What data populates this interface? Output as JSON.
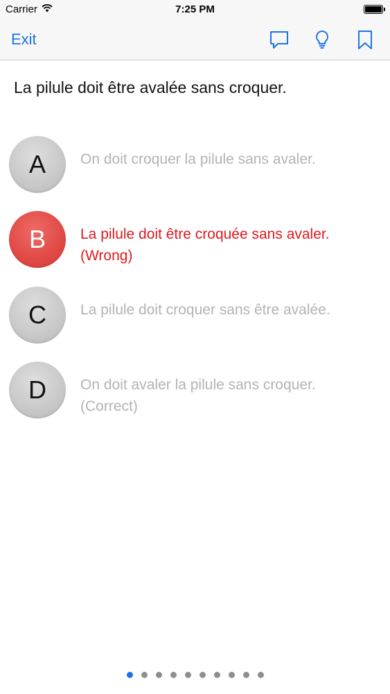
{
  "status_bar": {
    "carrier": "Carrier",
    "time": "7:25 PM",
    "icons": [
      "wifi-icon",
      "battery-icon"
    ]
  },
  "nav": {
    "exit_label": "Exit",
    "icons": [
      "comment-icon",
      "lightbulb-icon",
      "bookmark-icon"
    ],
    "accent_color": "#1a73e8"
  },
  "question": {
    "text": "La pilule doit être avalée sans croquer."
  },
  "answers": [
    {
      "letter": "A",
      "text": "On doit croquer la pilule sans avaler.",
      "state": "neutral"
    },
    {
      "letter": "B",
      "text": "La pilule doit être croquée sans avaler. (Wrong)",
      "state": "wrong"
    },
    {
      "letter": "C",
      "text": "La pilule doit croquer sans être avalée.",
      "state": "neutral"
    },
    {
      "letter": "D",
      "text": "On doit avaler la pilule sans croquer. (Correct)",
      "state": "neutral"
    }
  ],
  "colors": {
    "wrong": "#e0191e",
    "muted_text": "#b3b3b3",
    "wrong_circle": "#e04945",
    "neutral_circle": "#c8c8c8"
  },
  "pagination": {
    "total": 10,
    "current": 1
  }
}
